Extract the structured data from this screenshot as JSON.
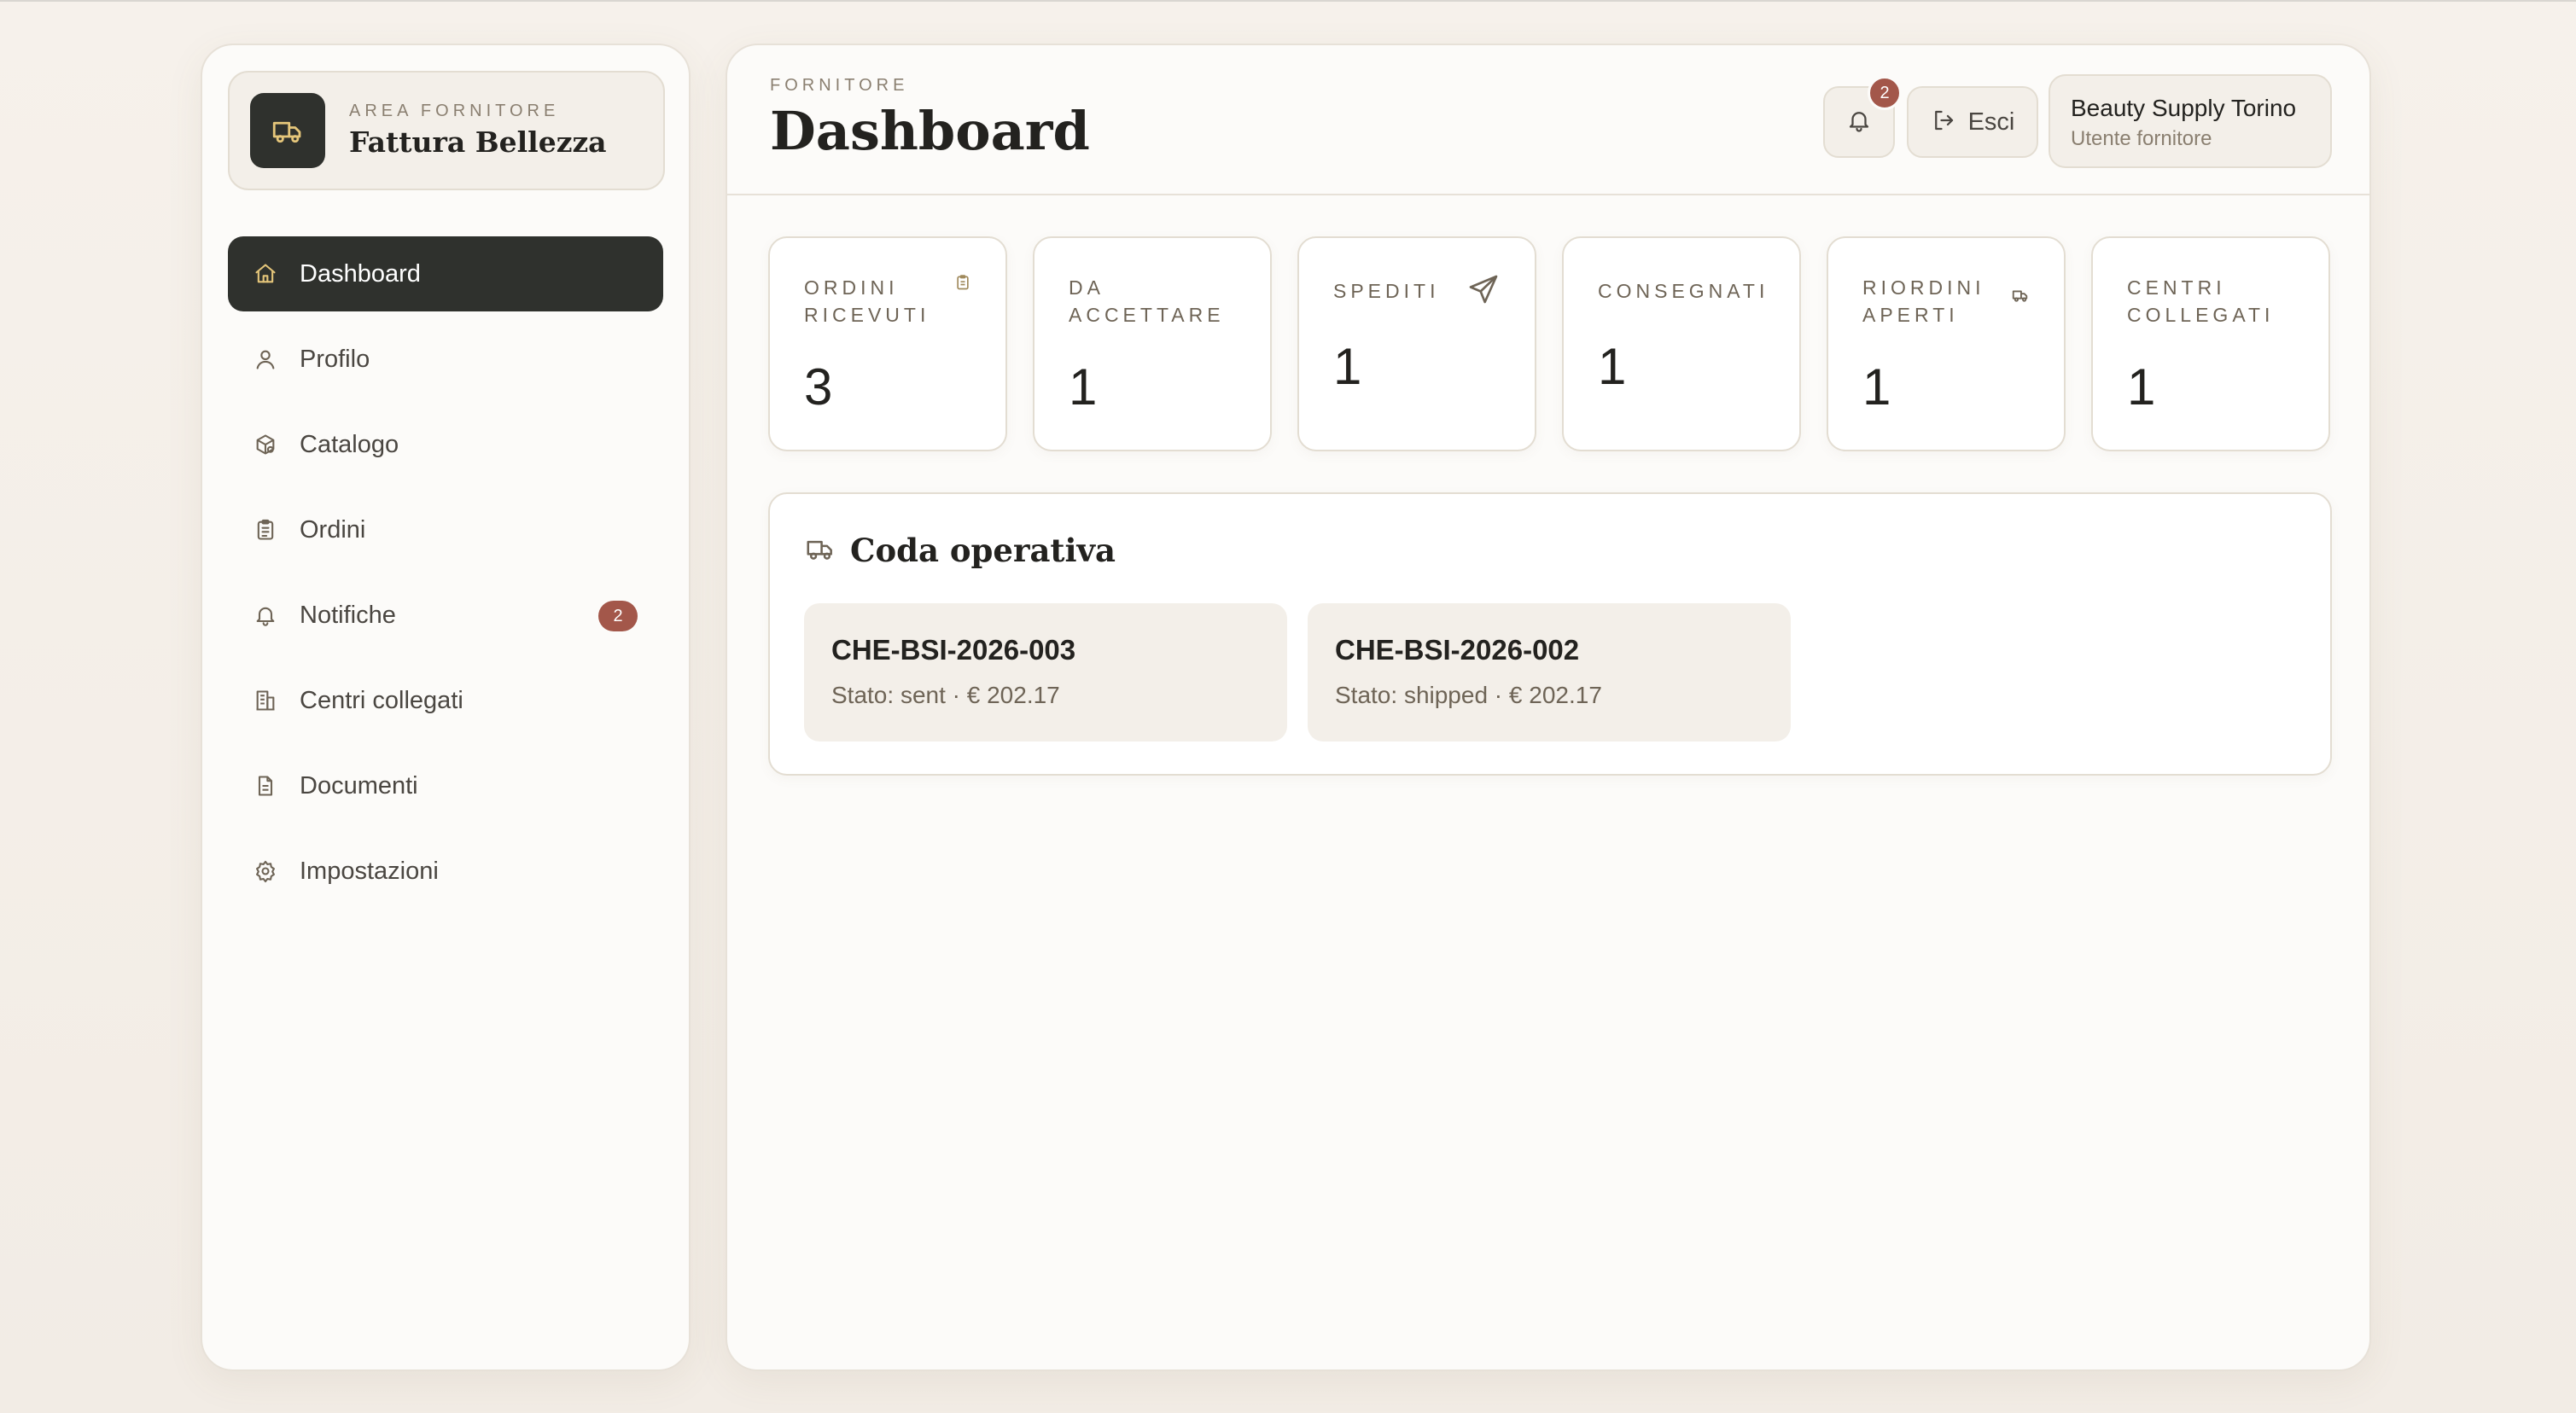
{
  "sidebar": {
    "brand": {
      "kicker": "AREA FORNITORE",
      "name": "Fattura Bellezza",
      "logo_icon": "truck-icon"
    },
    "items": [
      {
        "label": "Dashboard",
        "icon": "home-icon",
        "active": true
      },
      {
        "label": "Profilo",
        "icon": "user-icon"
      },
      {
        "label": "Catalogo",
        "icon": "package-icon"
      },
      {
        "label": "Ordini",
        "icon": "clipboard-icon"
      },
      {
        "label": "Notifiche",
        "icon": "bell-icon",
        "badge": "2"
      },
      {
        "label": "Centri collegati",
        "icon": "building-icon"
      },
      {
        "label": "Documenti",
        "icon": "document-icon"
      },
      {
        "label": "Impostazioni",
        "icon": "gear-icon"
      }
    ]
  },
  "header": {
    "kicker": "FORNITORE",
    "title": "Dashboard",
    "notifications_badge": "2",
    "logout_label": "Esci",
    "user": {
      "name": "Beauty Supply Torino",
      "role": "Utente fornitore"
    }
  },
  "stats": [
    {
      "label": "Ordini ricevuti",
      "value": "3",
      "icon": "clipboard-icon"
    },
    {
      "label": "Da accettare",
      "value": "1"
    },
    {
      "label": "Spediti",
      "value": "1",
      "icon": "send-icon"
    },
    {
      "label": "Consegnati",
      "value": "1"
    },
    {
      "label": "Riordini aperti",
      "value": "1",
      "icon": "truck-icon"
    },
    {
      "label": "Centri collegati",
      "value": "1"
    }
  ],
  "queue": {
    "title": "Coda operativa",
    "icon": "truck-icon",
    "items": [
      {
        "code": "CHE-BSI-2026-003",
        "meta": "Stato: sent · € 202.17"
      },
      {
        "code": "CHE-BSI-2026-002",
        "meta": "Stato: shipped · € 202.17"
      }
    ]
  },
  "colors": {
    "accent_dark": "#2f312d",
    "badge": "#a3574a",
    "background": "#f4efe9",
    "surface": "#fcfbf9",
    "muted_text": "#8a7f70"
  }
}
